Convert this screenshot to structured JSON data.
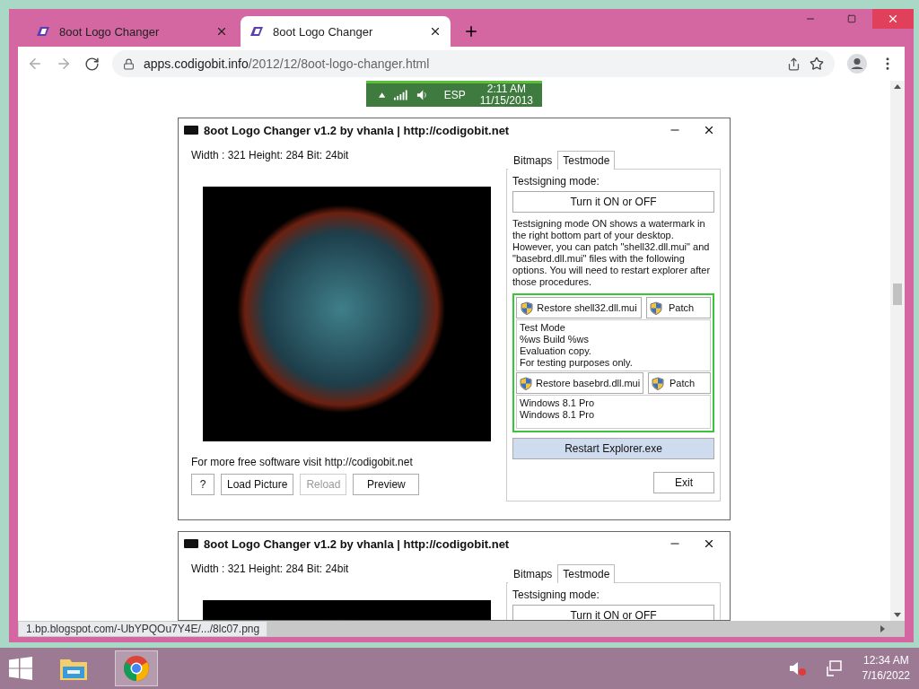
{
  "browser": {
    "tabs": [
      {
        "title": "8oot Logo Changer",
        "selected": false
      },
      {
        "title": "8oot Logo Changer",
        "selected": true
      }
    ],
    "url_host": "apps.codigobit.info",
    "url_path": "/2012/12/8oot-logo-changer.html",
    "status_url": "1.bp.blogspot.com/-UbYPQOu7Y4E/.../8lc07.png"
  },
  "tray_image": {
    "language": "ESP",
    "time": "2:11 AM",
    "date": "11/15/2013"
  },
  "app_windows": [
    {
      "title": "8oot Logo Changer v1.2 by vhanla | http://codigobit.net",
      "info": "Width : 321 Height: 284 Bit: 24bit",
      "tabs": [
        {
          "label": "Bitmaps",
          "selected": false
        },
        {
          "label": "Testmode",
          "selected": true
        }
      ],
      "testsigning_label": "Testsigning mode:",
      "toggle_button": "Turn it ON or OFF",
      "description": "Testsigning mode ON shows a watermark in the right bottom part of your desktop. However,  you can patch \"shell32.dll.mui\" and \"basebrd.dll.mui\" files with the following options. You will need to restart explorer after those procedures.",
      "patches": [
        {
          "restore_button": "Restore shell32.dll.mui",
          "patch_button": "Patch",
          "lines": [
            "Test Mode",
            "%ws Build %ws",
            "Evaluation copy.",
            "For testing purposes only."
          ]
        },
        {
          "restore_button": "Restore basebrd.dll.mui",
          "patch_button": "Patch",
          "lines": [
            "Windows 8.1 Pro",
            "Windows 8.1 Pro"
          ]
        }
      ],
      "restart_button": "Restart Explorer.exe",
      "exit_button": "Exit",
      "footer_text": "For more free software visit  http://codigobit.net",
      "buttons": [
        {
          "label": "?",
          "disabled": false
        },
        {
          "label": "Load Picture",
          "disabled": false
        },
        {
          "label": "Reload",
          "disabled": true
        },
        {
          "label": "Preview",
          "disabled": false
        }
      ]
    },
    {
      "title": "8oot Logo Changer v1.2 by vhanla | http://codigobit.net",
      "info": "Width : 321 Height: 284 Bit: 24bit",
      "tabs": [
        {
          "label": "Bitmaps",
          "selected": false
        },
        {
          "label": "Testmode",
          "selected": true
        }
      ],
      "testsigning_label": "Testsigning mode:",
      "toggle_button": "Turn it ON or OFF"
    }
  ],
  "desktop": {
    "time": "12:34 AM",
    "date": "7/16/2022"
  }
}
